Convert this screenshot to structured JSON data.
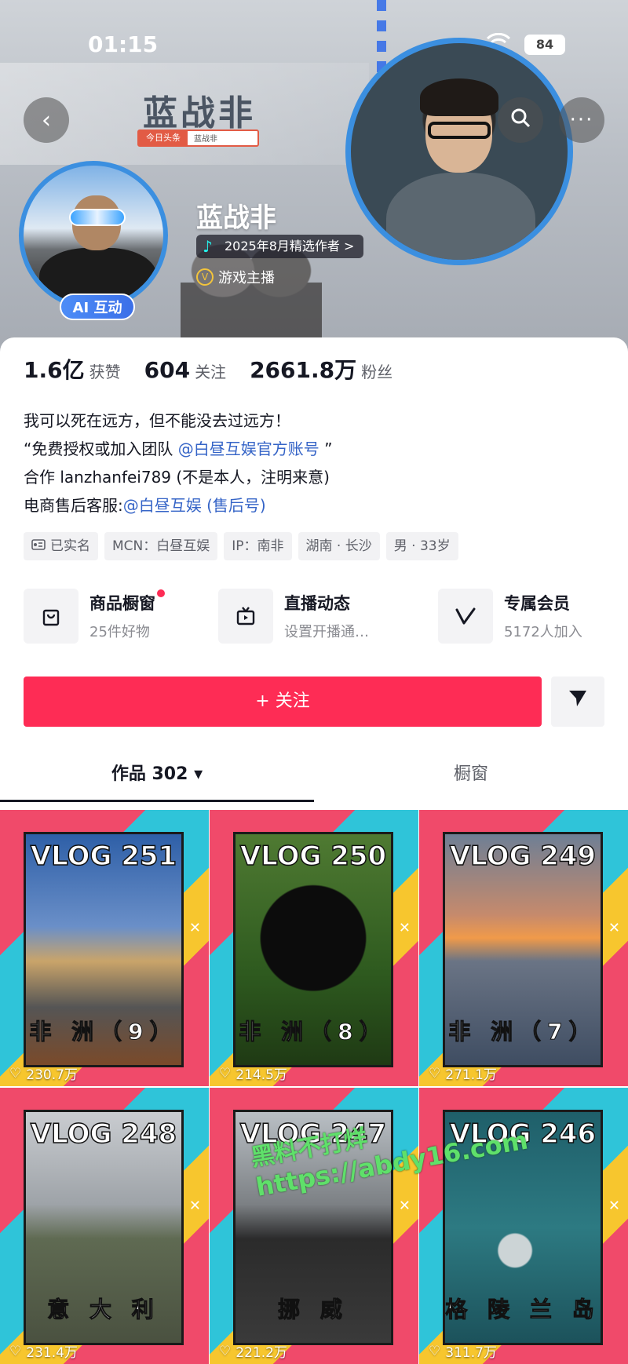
{
  "status_bar": {
    "time": "01:15",
    "battery": "84"
  },
  "cover": {
    "banner_title": "蓝战非",
    "search_tag": "今日头条",
    "search_text": "蓝战非"
  },
  "profile": {
    "name": "蓝战非",
    "creator_badge": "2025年8月精选作者 >",
    "role": "游戏主播",
    "ai_badge": "AI 互动"
  },
  "stats": [
    {
      "value": "1.6亿",
      "label": "获赞"
    },
    {
      "value": "604",
      "label": "关注"
    },
    {
      "value": "2661.8万",
      "label": "粉丝"
    }
  ],
  "bio": {
    "line1": "我可以死在远方，但不能没去过远方！",
    "line2_prefix": "“免费授权或加入团队 ",
    "line2_link": "@白昼互娱官方账号",
    "line2_suffix": " ”",
    "line3": "合作 lanzhanfei789 (不是本人，注明来意)",
    "line4_prefix": "电商售后客服:",
    "line4_link": "@白昼互娱 (售后号)"
  },
  "tags": [
    "已实名",
    "MCN：白昼互娱",
    "IP：南非",
    "湖南 · 长沙",
    "男 · 33岁"
  ],
  "features": [
    {
      "title": "商品橱窗",
      "sub": "25件好物",
      "icon": "shopping-bag-icon",
      "red_dot": true
    },
    {
      "title": "直播动态",
      "sub": "设置开播通…",
      "icon": "tv-icon",
      "red_dot": false
    },
    {
      "title": "专属会员",
      "sub": "5172人加入",
      "icon": "member-v-icon",
      "red_dot": false
    }
  ],
  "actions": {
    "follow": "+ 关注",
    "share_icon": "send-icon"
  },
  "tabs": {
    "works": "作品 302 ▾",
    "shop": "橱窗"
  },
  "videos": [
    {
      "title": "VLOG 251",
      "place": "非 洲（9）",
      "likes": "230.7万"
    },
    {
      "title": "VLOG 250",
      "place": "非 洲（8）",
      "likes": "214.5万"
    },
    {
      "title": "VLOG 249",
      "place": "非 洲（7）",
      "likes": "271.1万"
    },
    {
      "title": "VLOG 248",
      "place": "意 大 利",
      "likes": "231.4万"
    },
    {
      "title": "VLOG 247",
      "place": "挪 威",
      "likes": "221.2万"
    },
    {
      "title": "VLOG 246",
      "place": "格 陵 兰 岛",
      "likes": "311.7万"
    }
  ],
  "watermark": {
    "line1": "黑料不打烊",
    "line2": "https://abdy16.com"
  },
  "colors": {
    "accent": "#fe2c55",
    "link": "#3564c7",
    "avatar_ring": "#3b8fe0"
  }
}
